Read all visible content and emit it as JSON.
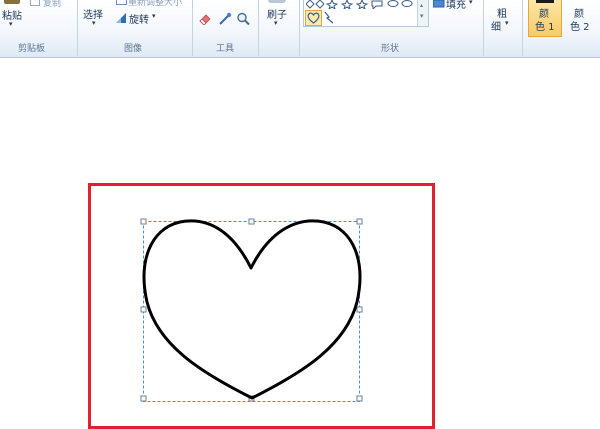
{
  "ribbon": {
    "clipboard": {
      "paste_label": "粘贴",
      "copy_label": "复制",
      "group_label": "剪贴板"
    },
    "image": {
      "select_label": "选择",
      "resize_label": "重新调整大小",
      "rotate_label": "旋转",
      "group_label": "图像"
    },
    "tools": {
      "group_label": "工具"
    },
    "brushes": {
      "label": "刷子"
    },
    "shapes": {
      "fill_label": "填充",
      "group_label": "形状"
    },
    "size": {
      "label_line1": "粗",
      "label_line2": "细"
    },
    "colors": {
      "color1_line1": "颜",
      "color1_line2": "色 1",
      "color2_line1": "颜",
      "color2_line2": "色 2"
    }
  },
  "canvas": {
    "frame_color": "#e0202a",
    "selection_color": "#4a90d9",
    "shape": "heart-outline"
  }
}
